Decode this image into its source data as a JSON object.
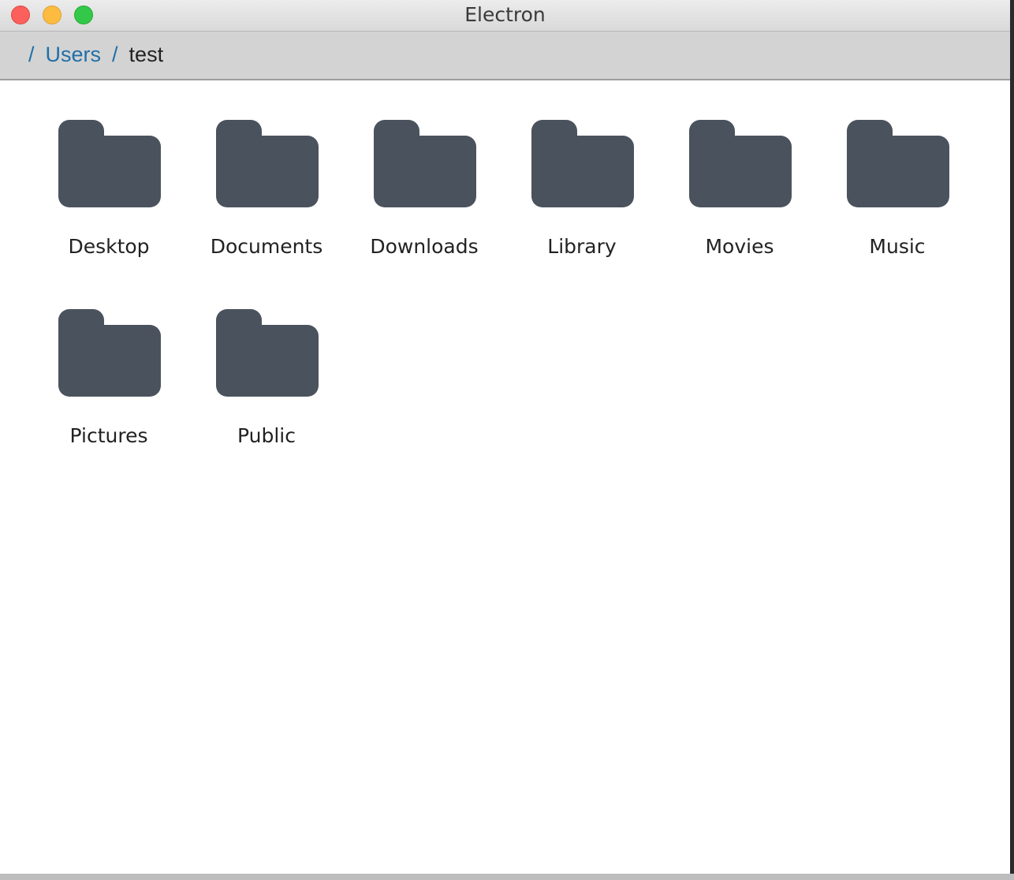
{
  "window": {
    "title": "Electron",
    "controls": {
      "close_icon": "close-traffic-light",
      "minimize_icon": "minimize-traffic-light",
      "zoom_icon": "zoom-traffic-light"
    }
  },
  "breadcrumb": {
    "separator": "/",
    "items": [
      {
        "label": "Users"
      },
      {
        "label": "test"
      }
    ]
  },
  "folders": [
    {
      "label": "Desktop",
      "icon": "folder-icon"
    },
    {
      "label": "Documents",
      "icon": "folder-icon"
    },
    {
      "label": "Downloads",
      "icon": "folder-icon"
    },
    {
      "label": "Library",
      "icon": "folder-icon"
    },
    {
      "label": "Movies",
      "icon": "folder-icon"
    },
    {
      "label": "Music",
      "icon": "folder-icon"
    },
    {
      "label": "Pictures",
      "icon": "folder-icon"
    },
    {
      "label": "Public",
      "icon": "folder-icon"
    }
  ],
  "colors": {
    "folder": "#4a535d",
    "link": "#1f6fa8",
    "breadcrumb_bg": "#d3d3d3"
  }
}
